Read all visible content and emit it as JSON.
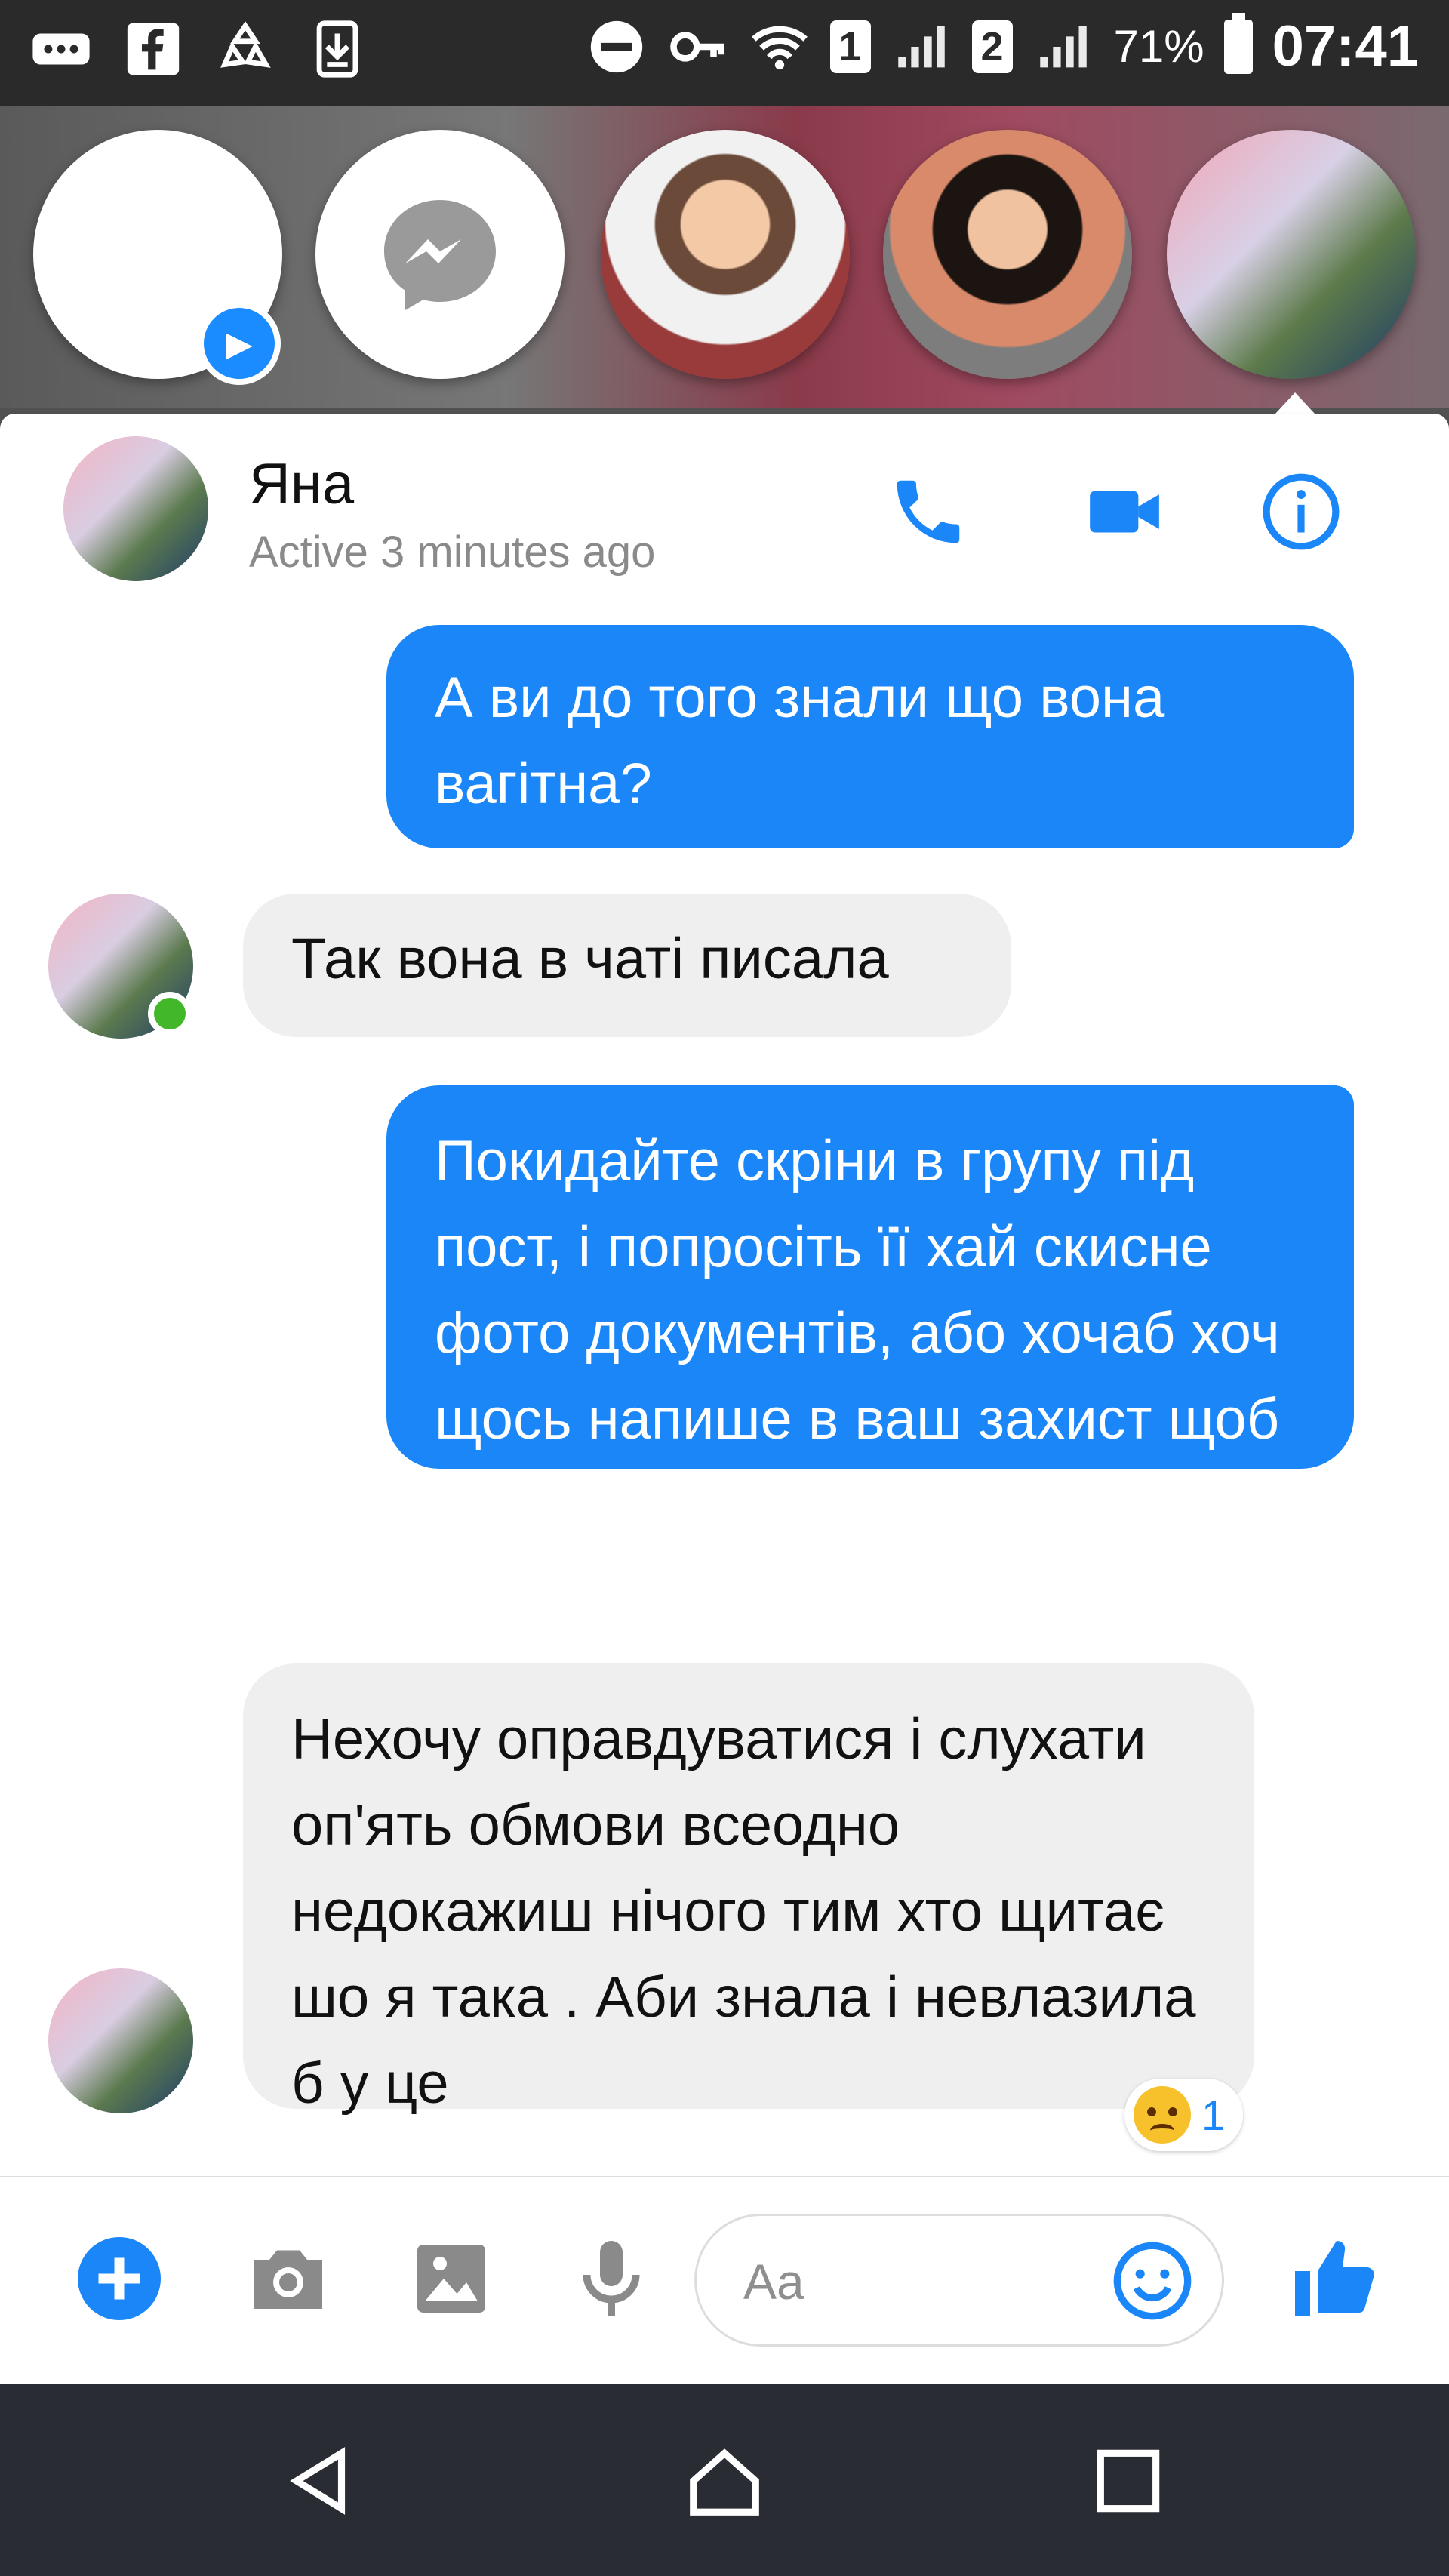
{
  "status_bar": {
    "sim1": "1",
    "sim2": "2",
    "battery": "71%",
    "time": "07:41",
    "icons": [
      "more-icon",
      "facebook-icon",
      "recycle-icon",
      "download-icon",
      "do-not-disturb-icon",
      "vpn-key-icon",
      "wifi-icon",
      "signal-icon",
      "battery-icon"
    ]
  },
  "chat_heads": [
    "chat-head-blank",
    "messenger-logo",
    "contact-photo-1",
    "contact-photo-2",
    "contact-photo-3"
  ],
  "header": {
    "name": "Яна",
    "status": "Active 3 minutes ago"
  },
  "messages": [
    {
      "from": "me",
      "text": "А ви до того знали що вона вагітна?"
    },
    {
      "from": "them",
      "text": "Так вона в чаті писала"
    },
    {
      "from": "me",
      "text": "Покидайте скріни в групу під пост, і попросіть її хай скисне фото документів, або хочаб хоч щось напише в ваш захист щоб вас не вважали шахрайкою."
    },
    {
      "from": "them",
      "text": "Нехочу оправдуватися і слухати оп'ять обмови всеодно недокажиш нічого тим хто щитає шо я така . Аби знала і невлазила б у це"
    }
  ],
  "reaction": {
    "emoji": "angry-face",
    "count": "1"
  },
  "composer": {
    "placeholder": "Aa"
  },
  "colors": {
    "accent": "#1a86f8",
    "incoming": "#efefef",
    "online": "#42b72a"
  }
}
